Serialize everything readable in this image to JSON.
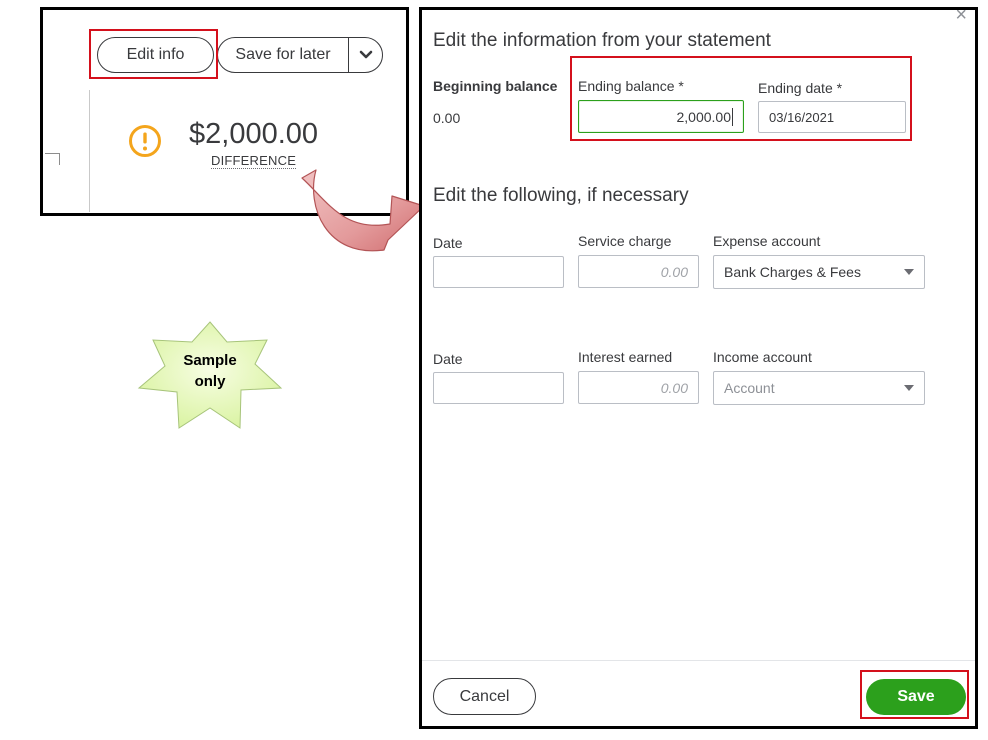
{
  "left_excerpt": {
    "edit_info_label": "Edit info",
    "save_for_later_label": "Save for later",
    "difference_amount": "$2,000.00",
    "difference_label": "DIFFERENCE",
    "warning_icon": "exclamation-circle-icon"
  },
  "sample_badge": {
    "line1": "Sample",
    "line2": "only",
    "color": "#e6f8b9"
  },
  "modal": {
    "title": "Edit the information from your statement",
    "beginning_balance_label": "Beginning balance",
    "beginning_balance_value": "0.00",
    "ending_balance_label": "Ending balance *",
    "ending_balance_value": "2,000.00",
    "ending_date_label": "Ending date *",
    "ending_date_value": "03/16/2021",
    "section2_title": "Edit the following, if necessary",
    "service_row": {
      "date_label": "Date",
      "date_value": "",
      "charge_label": "Service charge",
      "charge_placeholder": "0.00",
      "account_label": "Expense account",
      "account_value": "Bank Charges & Fees"
    },
    "interest_row": {
      "date_label": "Date",
      "date_value": "",
      "interest_label": "Interest earned",
      "interest_placeholder": "0.00",
      "account_label": "Income account",
      "account_placeholder": "Account"
    },
    "cancel_label": "Cancel",
    "save_label": "Save",
    "close_icon": "close-icon"
  },
  "colors": {
    "accent_green": "#2ca01c",
    "highlight_red": "#d4101c",
    "warning_orange": "#f4a51c",
    "arrow_red": "#d9777a"
  }
}
